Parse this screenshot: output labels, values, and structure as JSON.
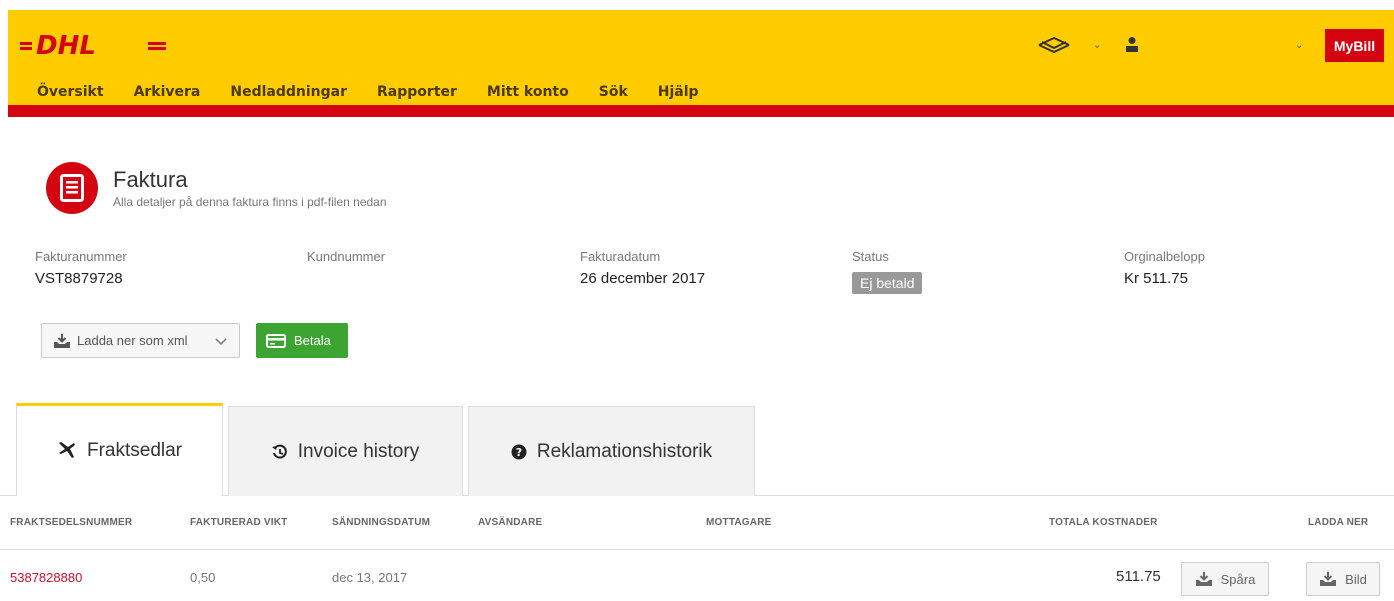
{
  "brand": {
    "logo_text": "DHL",
    "mybill_label": "MyBill",
    "yellow": "#FFCC00",
    "red": "#D40511"
  },
  "nav": {
    "items": [
      {
        "label": "Översikt"
      },
      {
        "label": "Arkivera"
      },
      {
        "label": "Nedladdningar"
      },
      {
        "label": "Rapporter"
      },
      {
        "label": "Mitt konto"
      },
      {
        "label": "Sök"
      },
      {
        "label": "Hjälp"
      }
    ]
  },
  "header_icons": {
    "language": "flag-icon",
    "user": "user-icon"
  },
  "invoice": {
    "title": "Faktura",
    "subtitle": "Alla detaljer på denna faktura finns i pdf-filen nedan",
    "fields": {
      "number_label": "Fakturanummer",
      "number_value": "VST8879728",
      "customer_label": "Kundnummer",
      "customer_value": "",
      "date_label": "Fakturadatum",
      "date_value": "26 december 2017",
      "status_label": "Status",
      "status_value": "Ej betald",
      "amount_label": "Orginalbelopp",
      "amount_value": "Kr 511.75"
    }
  },
  "actions": {
    "download_xml": "Ladda ner som xml",
    "pay": "Betala"
  },
  "tabs": [
    {
      "label": "Fraktsedlar",
      "icon": "plane-icon",
      "active": true
    },
    {
      "label": "Invoice history",
      "icon": "history-icon",
      "active": false
    },
    {
      "label": "Reklamationshistorik",
      "icon": "question-icon",
      "active": false
    }
  ],
  "table": {
    "headers": {
      "waybill": "FRAKTSEDELSNUMMER",
      "weight": "FAKTURERAD VIKT",
      "ship_date": "SÄNDNINGSDATUM",
      "sender": "AVSÄNDARE",
      "receiver": "MOTTAGARE",
      "total": "TOTALA KOSTNADER",
      "download": "LADDA NER"
    },
    "rows": [
      {
        "waybill": "5387828880",
        "weight": "0,50",
        "ship_date": "dec 13, 2017",
        "total": "511.75",
        "track_label": "Spåra",
        "image_label": "Bild"
      }
    ]
  }
}
